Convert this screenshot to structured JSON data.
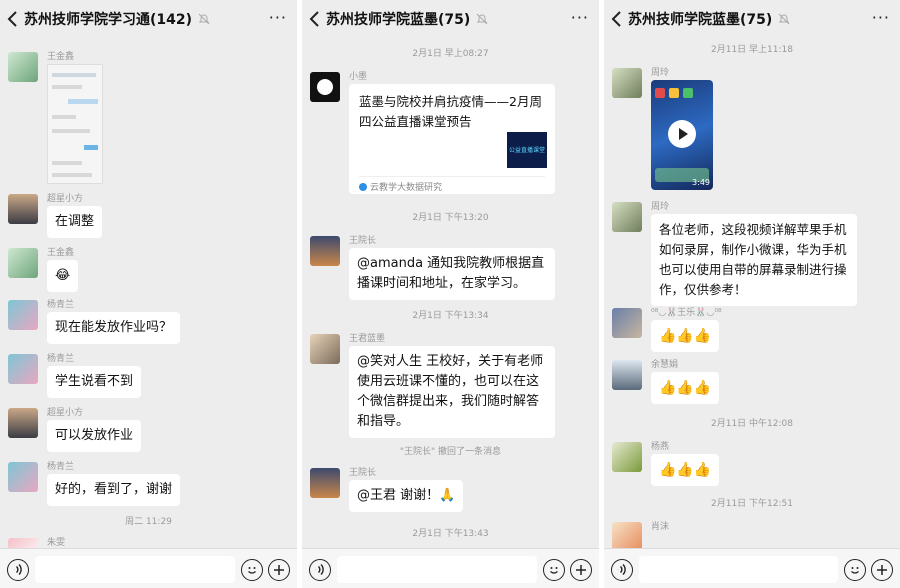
{
  "panels": [
    {
      "title": "苏州技师学院学习通(142)",
      "items": [
        {
          "name": "王金鑫",
          "type": "image"
        },
        {
          "name": "超星小方",
          "text": "在调整"
        },
        {
          "name": "王金鑫",
          "text": "😂"
        },
        {
          "name": "杨青兰",
          "text": "现在能发放作业吗？"
        },
        {
          "name": "杨青兰",
          "text": "学生说看不到"
        },
        {
          "name": "超星小方",
          "text": "可以发放作业"
        },
        {
          "name": "杨青兰",
          "text": "好的，看到了，谢谢"
        }
      ],
      "timestamp": "周二 11:29",
      "last_name": "朱雯"
    },
    {
      "title": "苏州技师学院蓝墨(75)",
      "ts1": "2月1日 早上08:27",
      "link": {
        "sender": "小墨",
        "title": "蓝墨与院校并肩抗疫情——2月周四公益直播课堂预告",
        "thumb_text": "公益直播课堂",
        "source": "云教学大数据研究"
      },
      "ts2": "2月1日 下午13:20",
      "msg1": {
        "name": "王院长",
        "text": "@amanda 通知我院教师根据直播课时间和地址，在家学习。"
      },
      "ts3": "2月1日 下午13:34",
      "msg2": {
        "name": "王君蓝墨",
        "text": "@笑对人生 王校好，关于有老师使用云班课不懂的，也可以在这个微信群提出来，我们随时解答和指导。"
      },
      "recall": "\"王院长\" 撤回了一条消息",
      "msg3": {
        "name": "王院长",
        "text": "@王君  谢谢！🙏"
      },
      "ts4": "2月1日 下午13:43"
    },
    {
      "title": "苏州技师学院蓝墨(75)",
      "ts1": "2月11日 早上11:18",
      "video": {
        "name": "周玲",
        "duration": "3:49"
      },
      "msg1": {
        "name": "周玲",
        "text": "各位老师，这段视频详解苹果手机如何录屏，制作小微课，华为手机也可以使用自带的屏幕录制进行操作，仅供参考！"
      },
      "msg2": {
        "name": "⁰⁸◡🐰王乐🐰◡⁰⁸",
        "text": "👍👍👍"
      },
      "msg3": {
        "name": "余慧娟",
        "text": "👍👍👍"
      },
      "ts2": "2月11日 中午12:08",
      "msg4": {
        "name": "杨燕",
        "text": "👍👍👍"
      },
      "ts3": "2月11日 下午12:51",
      "last_name": "肖沫"
    }
  ],
  "colors": {
    "bg": "#ededed",
    "bubble": "#ffffff",
    "meta": "#9a9a9a"
  }
}
